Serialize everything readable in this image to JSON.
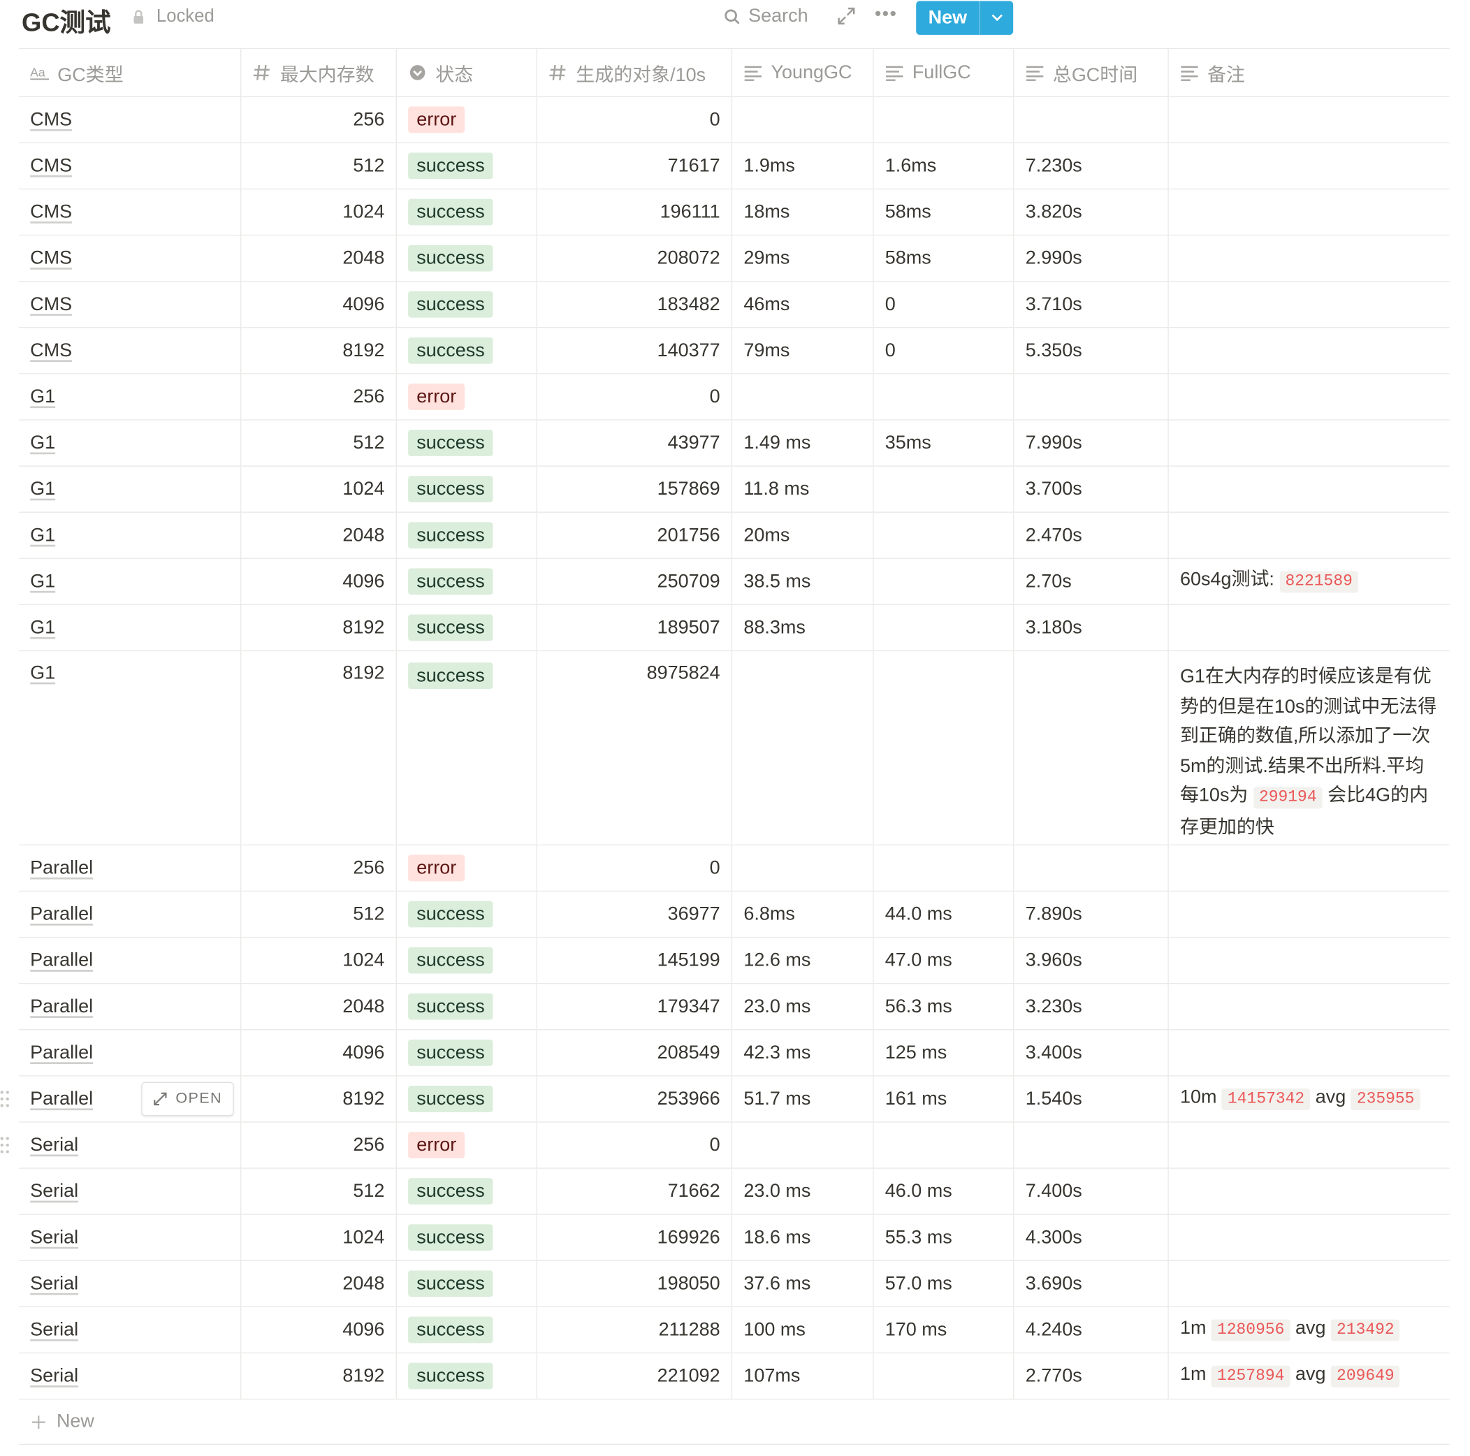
{
  "header": {
    "title": "GC测试",
    "lock_label": "Locked",
    "search_label": "Search",
    "more_label": "•••",
    "new_label": "New"
  },
  "columns": [
    {
      "label": "GC类型",
      "icon": "text-aa-icon"
    },
    {
      "label": "最大内存数",
      "icon": "number-hash-icon"
    },
    {
      "label": "状态",
      "icon": "select-chevron-icon"
    },
    {
      "label": "生成的对象/10s",
      "icon": "number-hash-icon"
    },
    {
      "label": "YoungGC",
      "icon": "text-lines-icon"
    },
    {
      "label": "FullGC",
      "icon": "text-lines-icon"
    },
    {
      "label": "总GC时间",
      "icon": "text-lines-icon"
    },
    {
      "label": "备注",
      "icon": "text-lines-icon"
    }
  ],
  "rows": [
    {
      "type": "CMS",
      "mem": "256",
      "status": "error",
      "objects": "0",
      "young": "",
      "full": "",
      "total": "",
      "note": []
    },
    {
      "type": "CMS",
      "mem": "512",
      "status": "success",
      "objects": "71617",
      "young": "1.9ms",
      "full": "1.6ms",
      "total": "7.230s",
      "note": []
    },
    {
      "type": "CMS",
      "mem": "1024",
      "status": "success",
      "objects": "196111",
      "young": "18ms",
      "full": "58ms",
      "total": "3.820s",
      "note": []
    },
    {
      "type": "CMS",
      "mem": "2048",
      "status": "success",
      "objects": "208072",
      "young": "29ms",
      "full": "58ms",
      "total": "2.990s",
      "note": []
    },
    {
      "type": "CMS",
      "mem": "4096",
      "status": "success",
      "objects": "183482",
      "young": "46ms",
      "full": "0",
      "total": "3.710s",
      "note": []
    },
    {
      "type": "CMS",
      "mem": "8192",
      "status": "success",
      "objects": "140377",
      "young": "79ms",
      "full": "0",
      "total": "5.350s",
      "note": []
    },
    {
      "type": "G1",
      "mem": "256",
      "status": "error",
      "objects": "0",
      "young": "",
      "full": "",
      "total": "",
      "note": []
    },
    {
      "type": "G1",
      "mem": "512",
      "status": "success",
      "objects": "43977",
      "young": "1.49 ms",
      "full": "35ms",
      "total": "7.990s",
      "note": []
    },
    {
      "type": "G1",
      "mem": "1024",
      "status": "success",
      "objects": "157869",
      "young": "11.8 ms",
      "full": "",
      "total": "3.700s",
      "note": []
    },
    {
      "type": "G1",
      "mem": "2048",
      "status": "success",
      "objects": "201756",
      "young": "20ms",
      "full": "",
      "total": "2.470s",
      "note": []
    },
    {
      "type": "G1",
      "mem": "4096",
      "status": "success",
      "objects": "250709",
      "young": "38.5 ms",
      "full": "",
      "total": "2.70s",
      "note": [
        {
          "t": "60s4g测试: "
        },
        {
          "c": "8221589"
        }
      ]
    },
    {
      "type": "G1",
      "mem": "8192",
      "status": "success",
      "objects": "189507",
      "young": "88.3ms",
      "full": "",
      "total": "3.180s",
      "note": []
    },
    {
      "type": "G1",
      "mem": "8192",
      "status": "success",
      "objects": "8975824",
      "young": "",
      "full": "",
      "total": "",
      "tall": true,
      "note": [
        {
          "t": "G1在大内存的时候应该是有优势的但是在10s的测试中无法得到正确的数值,所以添加了一次5m的测试.结果不出所料.平均每10s为 "
        },
        {
          "c": "299194"
        },
        {
          "t": " 会比4G的内存更加的快"
        }
      ]
    },
    {
      "type": "Parallel",
      "mem": "256",
      "status": "error",
      "objects": "0",
      "young": "",
      "full": "",
      "total": "",
      "note": []
    },
    {
      "type": "Parallel",
      "mem": "512",
      "status": "success",
      "objects": "36977",
      "young": "6.8ms",
      "full": "44.0 ms",
      "total": "7.890s",
      "note": []
    },
    {
      "type": "Parallel",
      "mem": "1024",
      "status": "success",
      "objects": "145199",
      "young": "12.6 ms",
      "full": "47.0 ms",
      "total": "3.960s",
      "note": []
    },
    {
      "type": "Parallel",
      "mem": "2048",
      "status": "success",
      "objects": "179347",
      "young": "23.0 ms",
      "full": "56.3 ms",
      "total": "3.230s",
      "note": []
    },
    {
      "type": "Parallel",
      "mem": "4096",
      "status": "success",
      "objects": "208549",
      "young": "42.3 ms",
      "full": "125 ms",
      "total": "3.400s",
      "note": []
    },
    {
      "type": "Parallel",
      "mem": "8192",
      "status": "success",
      "objects": "253966",
      "young": "51.7 ms",
      "full": "161 ms",
      "total": "1.540s",
      "hover": true,
      "note": [
        {
          "t": "10m "
        },
        {
          "c": "14157342"
        },
        {
          "t": "  avg "
        },
        {
          "c": "235955"
        }
      ]
    },
    {
      "type": "Serial",
      "mem": "256",
      "status": "error",
      "objects": "0",
      "young": "",
      "full": "",
      "total": "",
      "drag": true,
      "note": []
    },
    {
      "type": "Serial",
      "mem": "512",
      "status": "success",
      "objects": "71662",
      "young": "23.0 ms",
      "full": "46.0 ms",
      "total": "7.400s",
      "note": []
    },
    {
      "type": "Serial",
      "mem": "1024",
      "status": "success",
      "objects": "169926",
      "young": "18.6 ms",
      "full": "55.3 ms",
      "total": "4.300s",
      "note": []
    },
    {
      "type": "Serial",
      "mem": "2048",
      "status": "success",
      "objects": "198050",
      "young": "37.6 ms",
      "full": "57.0 ms",
      "total": "3.690s",
      "note": []
    },
    {
      "type": "Serial",
      "mem": "4096",
      "status": "success",
      "objects": "211288",
      "young": "100 ms",
      "full": "170 ms",
      "total": "4.240s",
      "note": [
        {
          "t": "1m "
        },
        {
          "c": "1280956"
        },
        {
          "t": " avg "
        },
        {
          "c": "213492"
        }
      ]
    },
    {
      "type": "Serial",
      "mem": "8192",
      "status": "success",
      "objects": "221092",
      "young": "107ms",
      "full": "",
      "total": "2.770s",
      "note": [
        {
          "t": "1m "
        },
        {
          "c": "1257894"
        },
        {
          "t": " avg "
        },
        {
          "c": "209649"
        }
      ]
    }
  ],
  "open_label": "OPEN",
  "add_row_label": "New",
  "colors": {
    "accent": "#2eaadc",
    "error_bg": "#ffe2dd",
    "success_bg": "#dbeddb",
    "code_text": "#eb5757"
  }
}
